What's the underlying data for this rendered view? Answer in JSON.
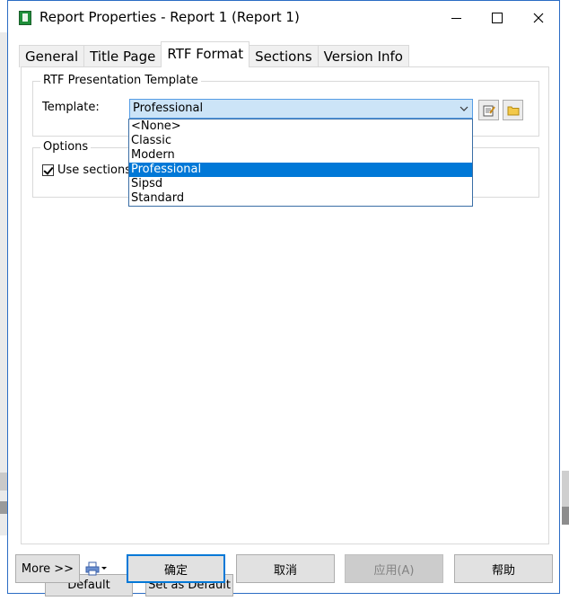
{
  "window": {
    "title": "Report Properties - Report 1 (Report 1)"
  },
  "tabs": [
    {
      "label": "General"
    },
    {
      "label": "Title Page"
    },
    {
      "label": "RTF Format",
      "active": true
    },
    {
      "label": "Sections"
    },
    {
      "label": "Version Info"
    }
  ],
  "rtf_group": {
    "label": "RTF Presentation Template",
    "template_label": "Template:",
    "template_value": "Professional"
  },
  "template_options": [
    "<None>",
    "Classic",
    "Modern",
    "Professional",
    "Sipsd",
    "Standard"
  ],
  "selected_option": "Professional",
  "options_group": {
    "label": "Options",
    "use_sections_label": "Use sections",
    "use_sections_checked": true
  },
  "buttons": {
    "default": "Default",
    "set_as_default": "Set as Default",
    "more": "More >>",
    "ok": "确定",
    "cancel": "取消",
    "apply": "应用(A)",
    "help": "帮助"
  },
  "colors": {
    "selection": "#0078d7",
    "combo_bg": "#cce4f7",
    "title_icon": "#1f8f3a"
  },
  "icons": [
    "report-icon",
    "minimize-icon",
    "maximize-icon",
    "close-icon",
    "chevron-down-icon",
    "edit-template-icon",
    "folder-icon",
    "print-icon"
  ]
}
